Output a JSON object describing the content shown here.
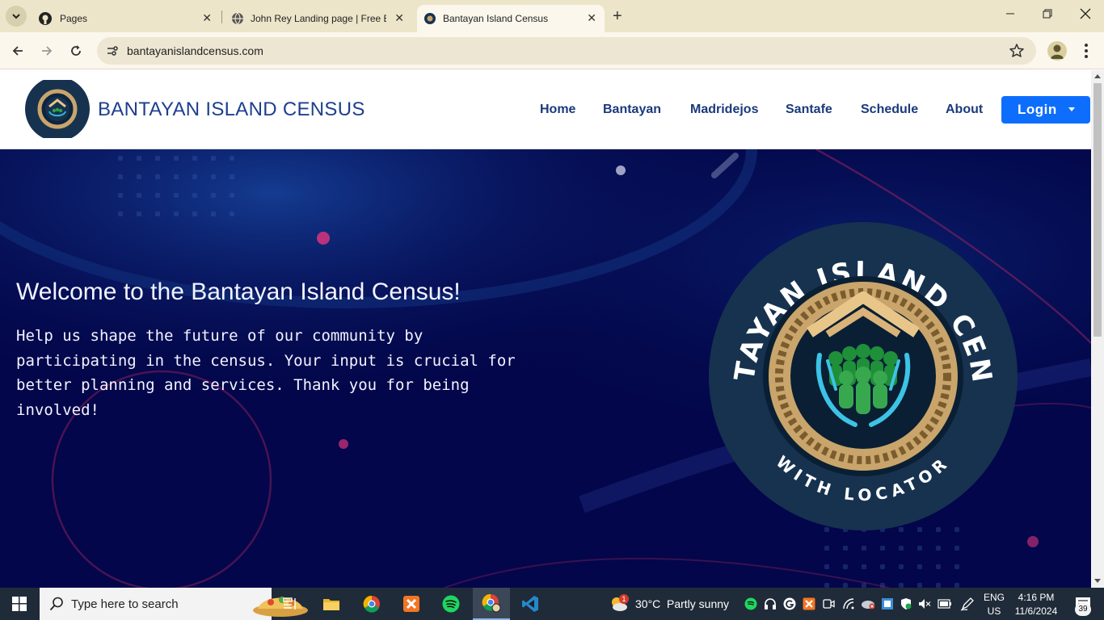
{
  "browser": {
    "tabs": [
      {
        "title": "Pages"
      },
      {
        "title": "John Rey Landing page | Free B"
      },
      {
        "title": "Bantayan Island Census"
      }
    ],
    "url": "bantayanislandcensus.com"
  },
  "site": {
    "brand": "BANTAYAN ISLAND CENSUS",
    "nav": [
      "Home",
      "Bantayan",
      "Madridejos",
      "Santafe",
      "Schedule",
      "About"
    ],
    "login_label": "Login",
    "logo": {
      "top_arc": "BANTAYAN ISLAND CENSUS",
      "bottom_arc": "WITH LOCATOR"
    },
    "hero": {
      "title": "Welcome to the Bantayan Island Census!",
      "text": "Help us shape the future of our community by participating in the census. Your input is crucial for better planning and services. Thank you for being involved!"
    }
  },
  "taskbar": {
    "search_placeholder": "Type here to search",
    "weather": {
      "temp": "30°C",
      "condition": "Partly sunny",
      "badge": "1"
    },
    "language": {
      "lang": "ENG",
      "region": "US"
    },
    "time": "4:16 PM",
    "date": "11/6/2024",
    "notification_count": "39"
  },
  "colors": {
    "tabbar": "#ede5c9",
    "toolbar": "#fbf7ec",
    "brand": "#1d3f8f",
    "login": "#0d6efd",
    "hero_bg": "#03064a",
    "taskbar": "#202b39"
  }
}
